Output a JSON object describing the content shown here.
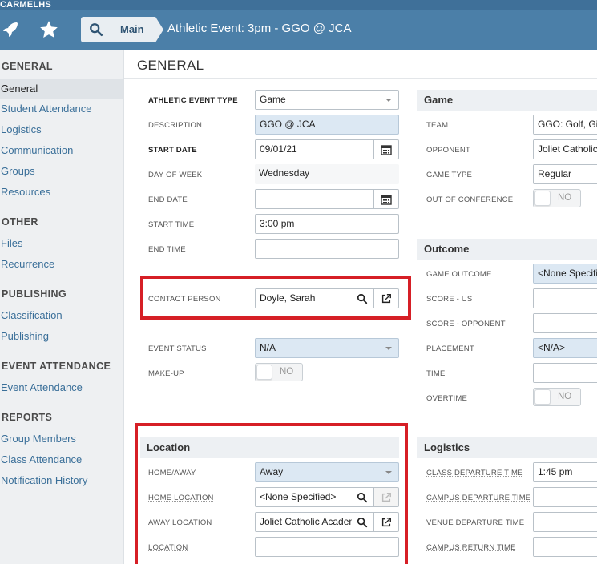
{
  "app": {
    "org_name": "CARMELHS",
    "breadcrumb_main": "Main",
    "page_heading": "Athletic Event: 3pm - GGO @ JCA"
  },
  "sidebar": {
    "sections": [
      {
        "title": "GENERAL",
        "items": [
          "General",
          "Student Attendance",
          "Logistics",
          "Communication",
          "Groups",
          "Resources"
        ]
      },
      {
        "title": "OTHER",
        "items": [
          "Files",
          "Recurrence"
        ]
      },
      {
        "title": "PUBLISHING",
        "items": [
          "Classification",
          "Publishing"
        ]
      },
      {
        "title": "EVENT ATTENDANCE",
        "items": [
          "Event Attendance"
        ]
      },
      {
        "title": "REPORTS",
        "items": [
          "Group Members",
          "Class Attendance",
          "Notification History"
        ]
      }
    ],
    "active_item": "General"
  },
  "main": {
    "title": "GENERAL",
    "left": {
      "athletic_event_type": {
        "label": "ATHLETIC EVENT TYPE",
        "value": "Game"
      },
      "description": {
        "label": "DESCRIPTION",
        "value": "GGO @ JCA"
      },
      "start_date": {
        "label": "START DATE",
        "value": "09/01/21"
      },
      "day_of_week": {
        "label": "DAY OF WEEK",
        "value": "Wednesday"
      },
      "end_date": {
        "label": "END DATE",
        "value": ""
      },
      "start_time": {
        "label": "START TIME",
        "value": "3:00 pm"
      },
      "end_time": {
        "label": "END TIME",
        "value": ""
      },
      "contact_person": {
        "label": "CONTACT PERSON",
        "value": "Doyle, Sarah"
      },
      "event_status": {
        "label": "EVENT STATUS",
        "value": "N/A"
      },
      "make_up": {
        "label": "MAKE-UP",
        "value": "NO"
      }
    },
    "location": {
      "title": "Location",
      "home_away": {
        "label": "HOME/AWAY",
        "value": "Away"
      },
      "home_location": {
        "label": "HOME LOCATION",
        "value": "<None Specified>"
      },
      "away_location": {
        "label": "AWAY LOCATION",
        "value": "Joliet Catholic Academy"
      },
      "location": {
        "label": "LOCATION",
        "value": ""
      }
    },
    "game": {
      "title": "Game",
      "team": {
        "label": "TEAM",
        "value": "GGO: Golf, Girls"
      },
      "opponent": {
        "label": "OPPONENT",
        "value": "Joliet Catholic"
      },
      "game_type": {
        "label": "GAME TYPE",
        "value": "Regular"
      },
      "out_of_conference": {
        "label": "OUT OF CONFERENCE",
        "value": "NO"
      }
    },
    "outcome": {
      "title": "Outcome",
      "game_outcome": {
        "label": "GAME OUTCOME",
        "value": "<None Specified>"
      },
      "score_us": {
        "label": "SCORE - US",
        "value": ""
      },
      "score_opponent": {
        "label": "SCORE - OPPONENT",
        "value": ""
      },
      "placement": {
        "label": "PLACEMENT",
        "value": "<N/A>"
      },
      "time": {
        "label": "TIME",
        "value": ""
      },
      "overtime": {
        "label": "OVERTIME",
        "value": "NO"
      }
    },
    "logistics": {
      "title": "Logistics",
      "class_departure_time": {
        "label": "CLASS DEPARTURE TIME",
        "value": "1:45 pm"
      },
      "campus_departure_time": {
        "label": "CAMPUS DEPARTURE TIME",
        "value": ""
      },
      "venue_departure_time": {
        "label": "VENUE DEPARTURE TIME",
        "value": ""
      },
      "campus_return_time": {
        "label": "CAMPUS RETURN TIME",
        "value": ""
      }
    }
  },
  "colors": {
    "topbar": "#4b7fa8",
    "highlight_box": "#d61f26",
    "link": "#3a6f99"
  },
  "icons": [
    "rocket-icon",
    "star-icon",
    "search-icon",
    "calendar-icon",
    "external-link-icon"
  ]
}
